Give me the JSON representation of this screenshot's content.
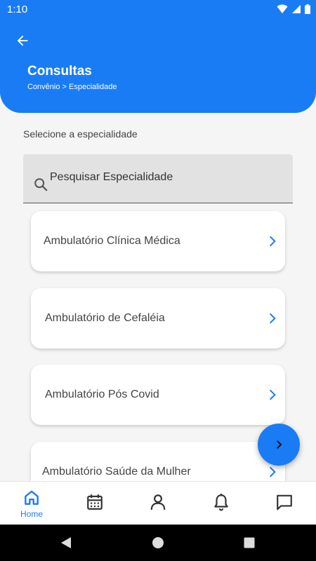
{
  "status_bar": {
    "time": "1:10"
  },
  "header": {
    "title": "Consultas",
    "breadcrumb": "Convênio > Especialidade",
    "color": "#1a7cf5"
  },
  "instruction": "Selecione a especialidade",
  "search": {
    "placeholder": "Pesquisar Especialidade",
    "value": ""
  },
  "specialties": [
    {
      "label": "Ambulatório Clínica Médica"
    },
    {
      "label": "Ambulatório de Cefaléia"
    },
    {
      "label": "Ambulatório Pós Covid"
    },
    {
      "label": "Ambulatório Saúde da Mulher"
    }
  ],
  "fab": {
    "icon": "chevron-right-icon"
  },
  "bottom_nav": {
    "items": [
      {
        "label": "Home",
        "icon": "home-icon",
        "active": true
      },
      {
        "icon": "calendar-icon"
      },
      {
        "icon": "user-icon"
      },
      {
        "icon": "bell-icon"
      },
      {
        "icon": "chat-icon"
      }
    ]
  },
  "accent_color": "#1a7cf5"
}
